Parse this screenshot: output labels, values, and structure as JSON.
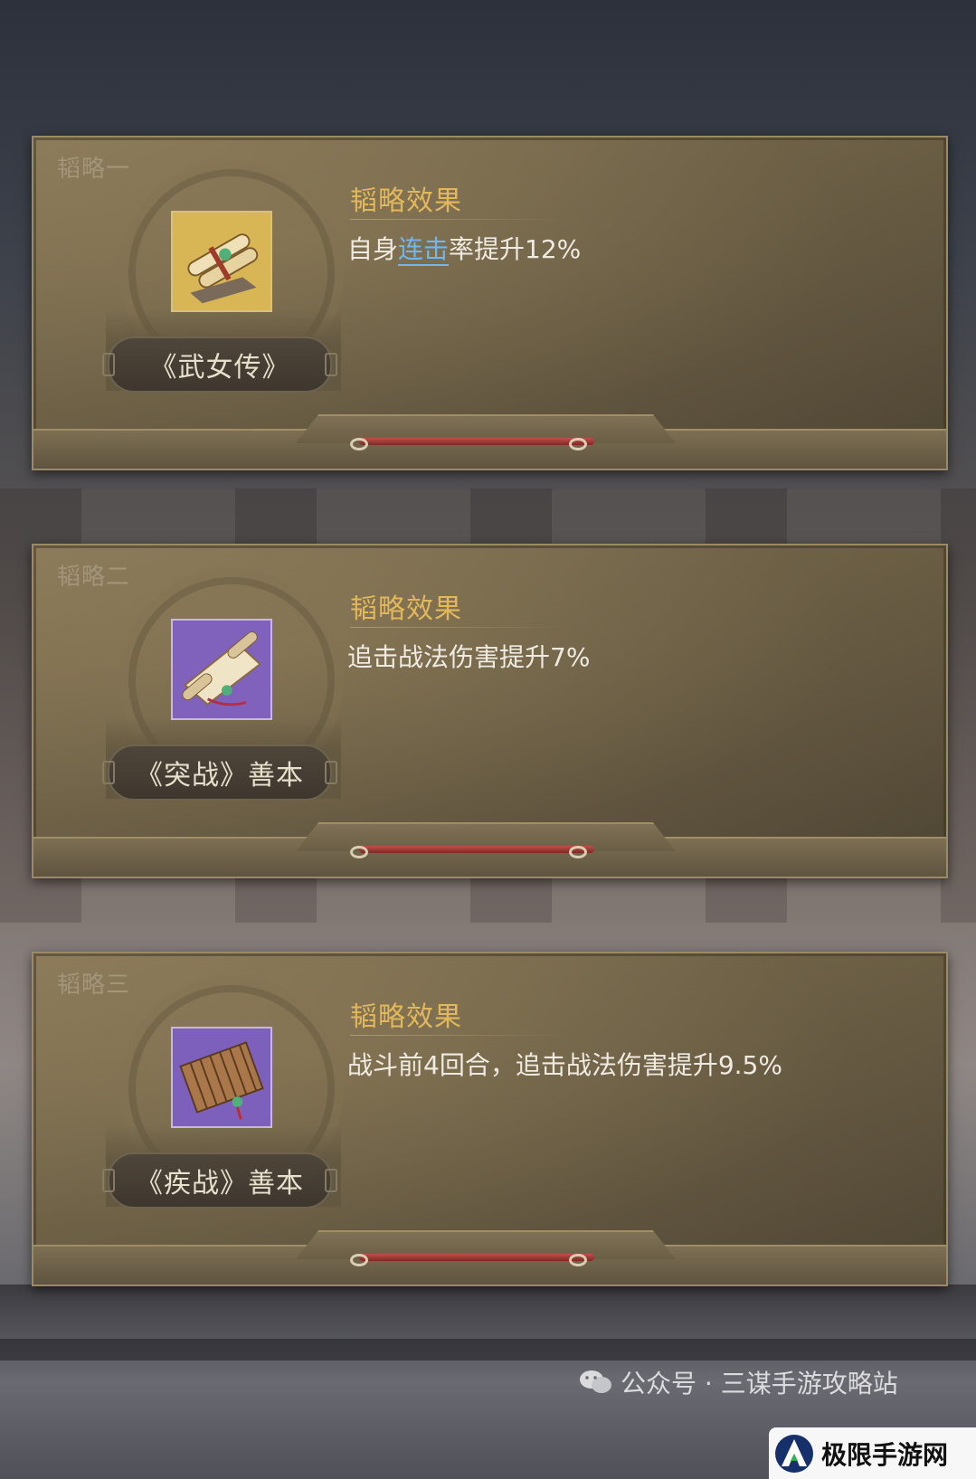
{
  "cards": [
    {
      "tier": "韬略一",
      "book": "《武女传》",
      "effect_title": "韬略效果",
      "effect_pre": "自身",
      "effect_hl": "连击",
      "effect_post": "率提升12%",
      "icon": "scroll-bundle-icon",
      "icon_bg": "#c9a64a"
    },
    {
      "tier": "韬略二",
      "book": "《突战》善本",
      "effect_title": "韬略效果",
      "effect": "追击战法伤害提升7%",
      "icon": "open-scroll-icon",
      "icon_bg": "#7a5bb5"
    },
    {
      "tier": "韬略三",
      "book": "《疾战》善本",
      "effect_title": "韬略效果",
      "effect": "战斗前4回合，追击战法伤害提升9.5%",
      "icon": "bamboo-book-icon",
      "icon_bg": "#7a5bb5"
    }
  ],
  "watermark": "公众号 · 三谋手游攻略站",
  "site_badge": "极限手游网",
  "colors": {
    "effect_title": "#e2b85a",
    "highlight": "#6fb7f0",
    "panel": "#6f6247"
  }
}
